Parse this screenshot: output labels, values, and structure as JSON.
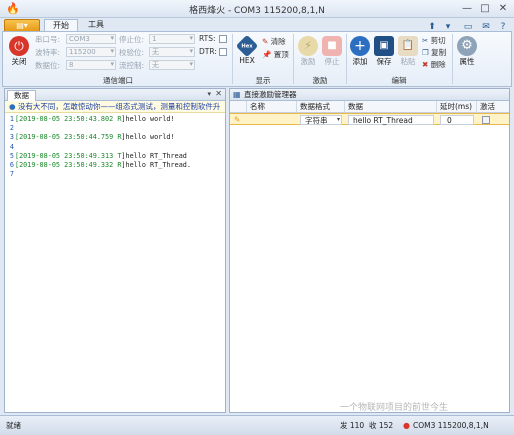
{
  "window": {
    "title": "格西烽火 - COM3  115200,8,1,N",
    "app_menu": "",
    "tabs": [
      "开始",
      "工具"
    ],
    "close_btn": "✕",
    "max_btn": "□",
    "min_btn": "—"
  },
  "ribbon": {
    "close_label": "关闭",
    "port_fields": [
      {
        "label": "串口号:",
        "value": "COM3"
      },
      {
        "label": "波特率:",
        "value": "115200"
      },
      {
        "label": "数据位:",
        "value": "8"
      }
    ],
    "port_fields2": [
      {
        "label": "停止位:",
        "value": "1"
      },
      {
        "label": "校验位:",
        "value": "无"
      },
      {
        "label": "流控制:",
        "value": "无"
      }
    ],
    "rts_label": "RTS:",
    "dtr_label": "DTR:",
    "group_port": "通信端口",
    "hex_label": "HEX",
    "clear_label": "清除",
    "pin_label": "置顶",
    "group_display": "显示",
    "start_label": "激励",
    "stop_label": "停止",
    "group_excite": "激励",
    "add_label": "添加",
    "save_label": "保存",
    "paste_label": "粘贴",
    "cut_label": "剪切",
    "copy_label": "复制",
    "delete_label": "删除",
    "group_edit": "编辑",
    "props_label": "属性"
  },
  "left": {
    "tab": "数据",
    "banner": "没有大不同，怎敢惊动你——组态式测试，测量和控制软件升",
    "lines": [
      {
        "n": "1",
        "ts": "[2019-08-05 23:50:43.802 ",
        "dir": "R",
        "msg": "]hello world!"
      },
      {
        "n": "2",
        "ts": "",
        "dir": "",
        "msg": ""
      },
      {
        "n": "3",
        "ts": "[2019-08-05 23:50:44.759 ",
        "dir": "R",
        "msg": "]hello world!"
      },
      {
        "n": "4",
        "ts": "",
        "dir": "",
        "msg": ""
      },
      {
        "n": "5",
        "ts": "[2019-08-05 23:50:49.313 ",
        "dir": "T",
        "msg": "]hello RT_Thread"
      },
      {
        "n": "6",
        "ts": "[2019-08-05 23:50:49.332 ",
        "dir": "R",
        "msg": "]hello RT_Thread."
      },
      {
        "n": "7",
        "ts": "",
        "dir": "",
        "msg": ""
      }
    ]
  },
  "right": {
    "title": "直接激励管理器",
    "columns": [
      "名称",
      "数据格式",
      "数据",
      "延时(ms)",
      "激活"
    ],
    "row": {
      "name": "",
      "format": "字符串",
      "data": "hello RT_Thread",
      "delay": "0"
    }
  },
  "status": {
    "ready": "就绪",
    "sent": "发 110",
    "recv": "收 152",
    "port": "COM3  115200,8,1,N",
    "watermark": "一个物联网项目的前世今生"
  },
  "colors": {
    "accent": "#2c5d95",
    "ts_green": "#1b8a2a",
    "row_highlight": "#fff3c7",
    "app_orange": "#e89a17"
  }
}
